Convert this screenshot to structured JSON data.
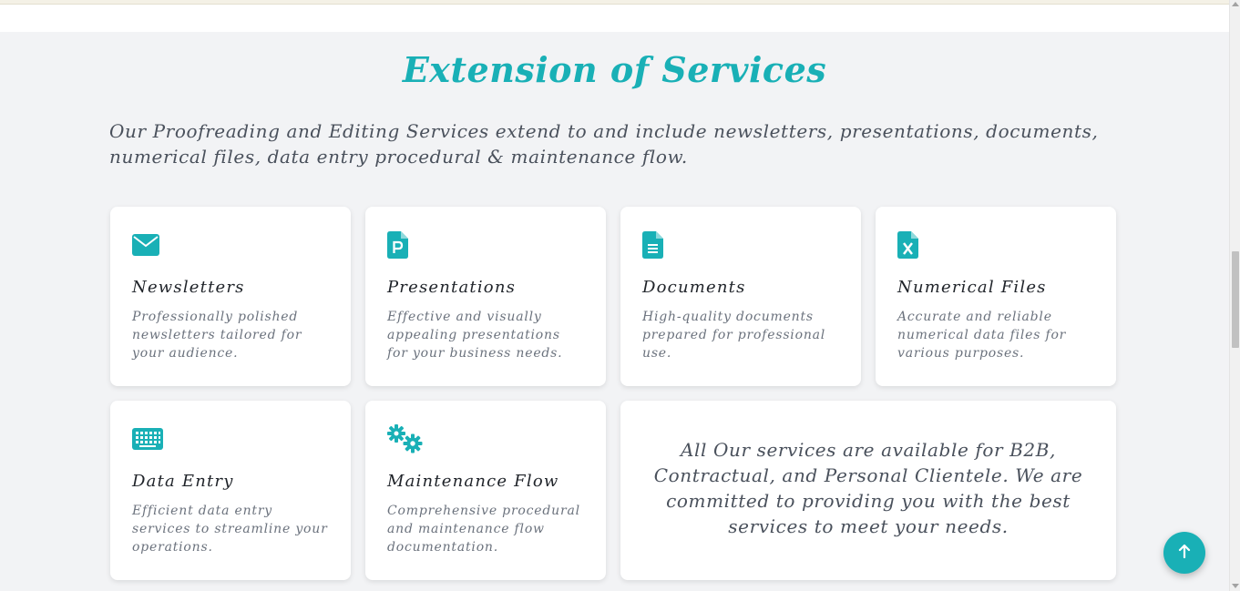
{
  "section": {
    "title": "Extension of Services",
    "intro": "Our Proofreading and Editing Services extend to and include newsletters, presentations, documents, numerical files, data entry procedural & maintenance flow."
  },
  "cards": [
    {
      "icon": "envelope-icon",
      "title": "Newsletters",
      "description": "Professionally polished newsletters tailored for your audience."
    },
    {
      "icon": "powerpoint-file-icon",
      "title": "Presentations",
      "description": "Effective and visually appealing presentations for your business needs."
    },
    {
      "icon": "document-file-icon",
      "title": "Documents",
      "description": "High-quality documents prepared for professional use."
    },
    {
      "icon": "excel-file-icon",
      "title": "Numerical Files",
      "description": "Accurate and reliable numerical data files for various purposes."
    },
    {
      "icon": "keyboard-icon",
      "title": "Data Entry",
      "description": "Efficient data entry services to streamline your operations."
    },
    {
      "icon": "gears-icon",
      "title": "Maintenance Flow",
      "description": "Comprehensive procedural and maintenance flow documentation."
    }
  ],
  "clientele_note": "All Our services are available for B2B, Contractual, and Personal Clientele. We are committed to providing you with the best services to meet your needs.",
  "back_to_top": {
    "icon": "arrow-up-icon"
  },
  "colors": {
    "accent": "#19b0b6",
    "background": "#f2f3f5",
    "card": "#ffffff"
  }
}
